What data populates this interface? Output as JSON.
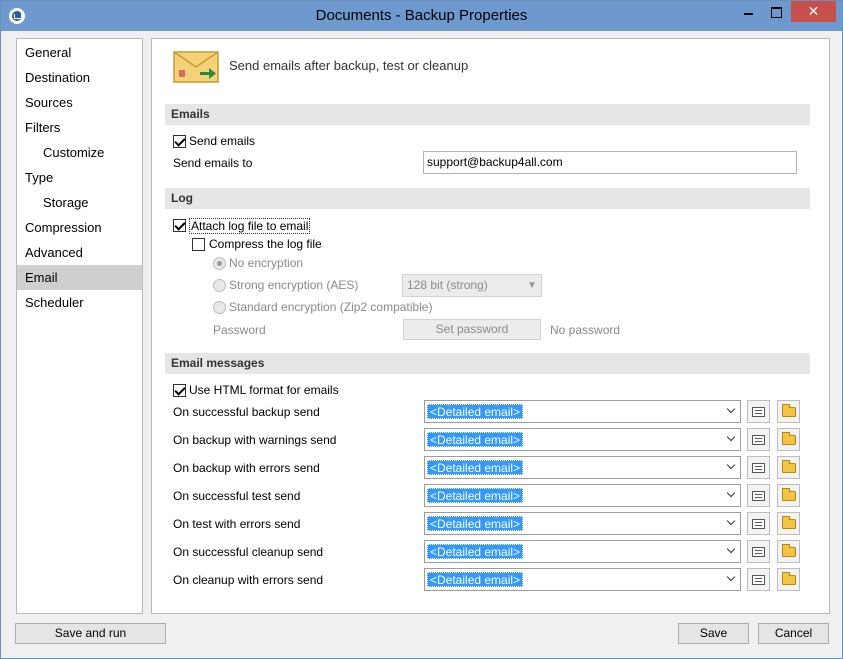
{
  "window": {
    "title": "Documents - Backup Properties",
    "close_glyph": "✕"
  },
  "nav": {
    "items": [
      {
        "label": "General",
        "sub": false,
        "active": false
      },
      {
        "label": "Destination",
        "sub": false,
        "active": false
      },
      {
        "label": "Sources",
        "sub": false,
        "active": false
      },
      {
        "label": "Filters",
        "sub": false,
        "active": false
      },
      {
        "label": "Customize",
        "sub": true,
        "active": false
      },
      {
        "label": "Type",
        "sub": false,
        "active": false
      },
      {
        "label": "Storage",
        "sub": true,
        "active": false
      },
      {
        "label": "Compression",
        "sub": false,
        "active": false
      },
      {
        "label": "Advanced",
        "sub": false,
        "active": false
      },
      {
        "label": "Email",
        "sub": false,
        "active": true
      },
      {
        "label": "Scheduler",
        "sub": false,
        "active": false
      }
    ]
  },
  "header": {
    "icon": "email-envelope-icon",
    "text": "Send emails after backup, test or cleanup"
  },
  "emails": {
    "section_title": "Emails",
    "send_emails_label": "Send emails",
    "send_emails_checked": true,
    "send_to_label": "Send emails to",
    "send_to_value": "support@backup4all.com"
  },
  "log": {
    "section_title": "Log",
    "attach_label": "Attach log file to email",
    "attach_checked": true,
    "compress_label": "Compress the log file",
    "compress_checked": false,
    "no_encryption_label": "No encryption",
    "strong_encryption_label": "Strong encryption (AES)",
    "standard_encryption_label": "Standard encryption (Zip2 compatible)",
    "selected_encryption": "No encryption",
    "aes_strength_value": "128 bit (strong)",
    "password_label": "Password",
    "set_password_label": "Set password",
    "password_status": "No password"
  },
  "messages": {
    "section_title": "Email messages",
    "html_format_label": "Use HTML format for emails",
    "html_format_checked": true,
    "rows": [
      {
        "label": "On successful backup send",
        "value": "<Detailed email>"
      },
      {
        "label": "On backup with warnings send",
        "value": "<Detailed email>"
      },
      {
        "label": "On backup with errors send",
        "value": "<Detailed email>"
      },
      {
        "label": "On successful test send",
        "value": "<Detailed email>"
      },
      {
        "label": "On test with errors send",
        "value": "<Detailed email>"
      },
      {
        "label": "On successful cleanup send",
        "value": "<Detailed email>"
      },
      {
        "label": "On cleanup with errors send",
        "value": "<Detailed email>"
      }
    ]
  },
  "footer": {
    "save_and_run_label": "Save and run",
    "save_label": "Save",
    "cancel_label": "Cancel"
  },
  "colors": {
    "titlebar": "#6d99cf",
    "close": "#c7504c",
    "selection": "#3399ff"
  }
}
